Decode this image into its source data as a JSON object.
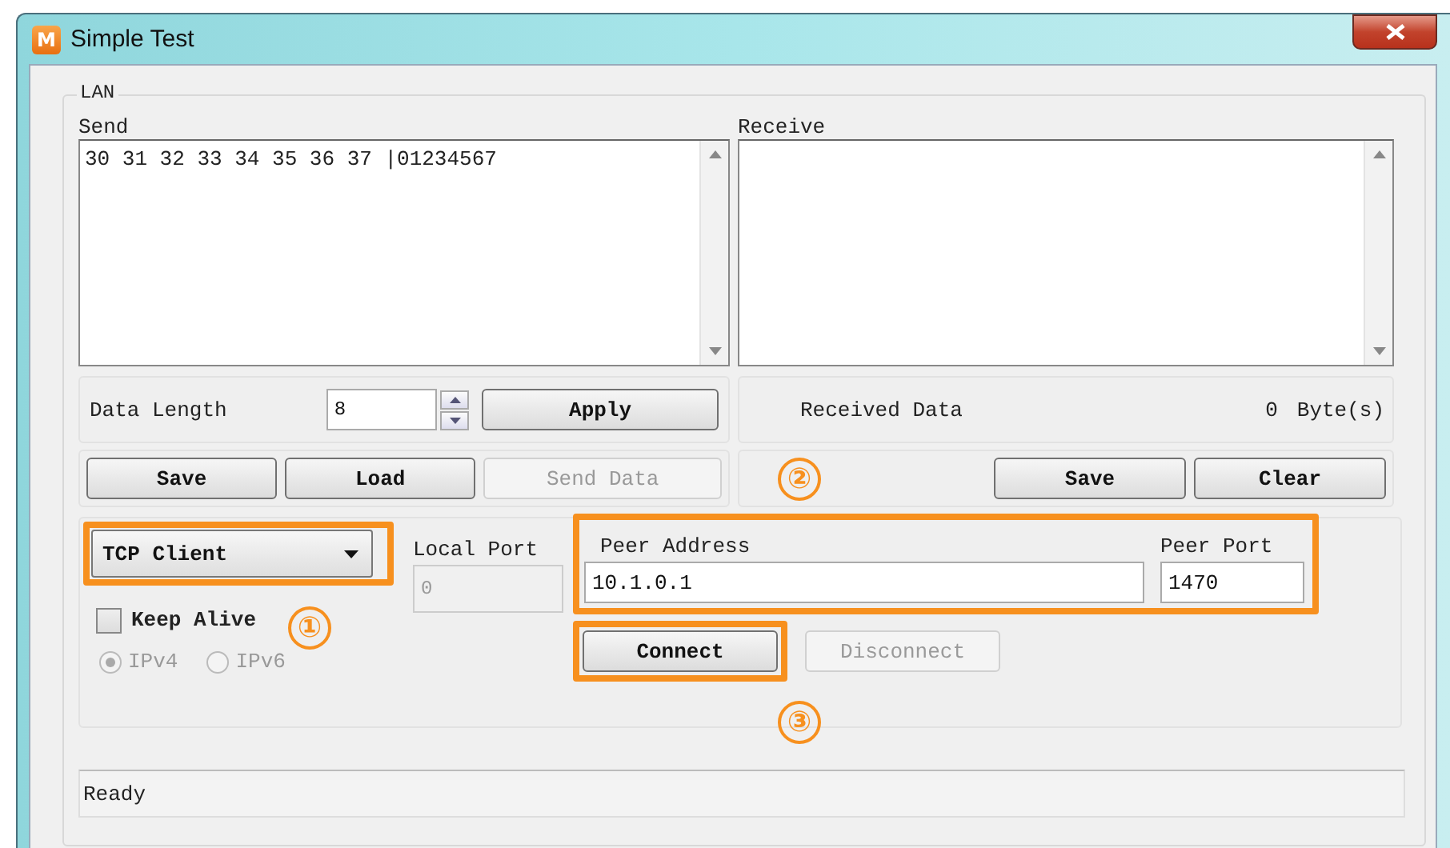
{
  "window": {
    "title": "Simple Test",
    "icon_letter": "M"
  },
  "group": {
    "title": "LAN"
  },
  "send": {
    "label": "Send",
    "value": "30 31 32 33 34 35 36 37 |01234567"
  },
  "receive": {
    "label": "Receive"
  },
  "data_length": {
    "label": "Data Length",
    "value": "8",
    "apply": "Apply"
  },
  "received_data": {
    "label": "Received Data",
    "count": "0",
    "unit": "Byte(s)"
  },
  "send_buttons": [
    {
      "label": "Save",
      "disabled": false
    },
    {
      "label": "Load",
      "disabled": false
    },
    {
      "label": "Send Data",
      "disabled": true
    }
  ],
  "receive_buttons": [
    {
      "label": "Save",
      "disabled": false
    },
    {
      "label": "Clear",
      "disabled": false
    }
  ],
  "mode": {
    "value": "TCP Client",
    "highlighted": true
  },
  "keep_alive": {
    "label": "Keep Alive",
    "checked": false
  },
  "ip_versions": [
    {
      "label": "IPv4",
      "selected": true,
      "disabled": true
    },
    {
      "label": "IPv6",
      "selected": false,
      "disabled": true
    }
  ],
  "local_port": {
    "label": "Local Port",
    "value": "0",
    "disabled": true
  },
  "peer": {
    "highlighted": true,
    "address_label": "Peer Address",
    "address": "10.1.0.1",
    "port_label": "Peer Port",
    "port": "1470"
  },
  "connection_buttons": [
    {
      "label": "Connect",
      "disabled": false,
      "highlighted": true
    },
    {
      "label": "Disconnect",
      "disabled": true,
      "highlighted": false
    }
  ],
  "callouts": [
    "①",
    "②",
    "③"
  ],
  "status_bar": {
    "text": "Ready"
  }
}
